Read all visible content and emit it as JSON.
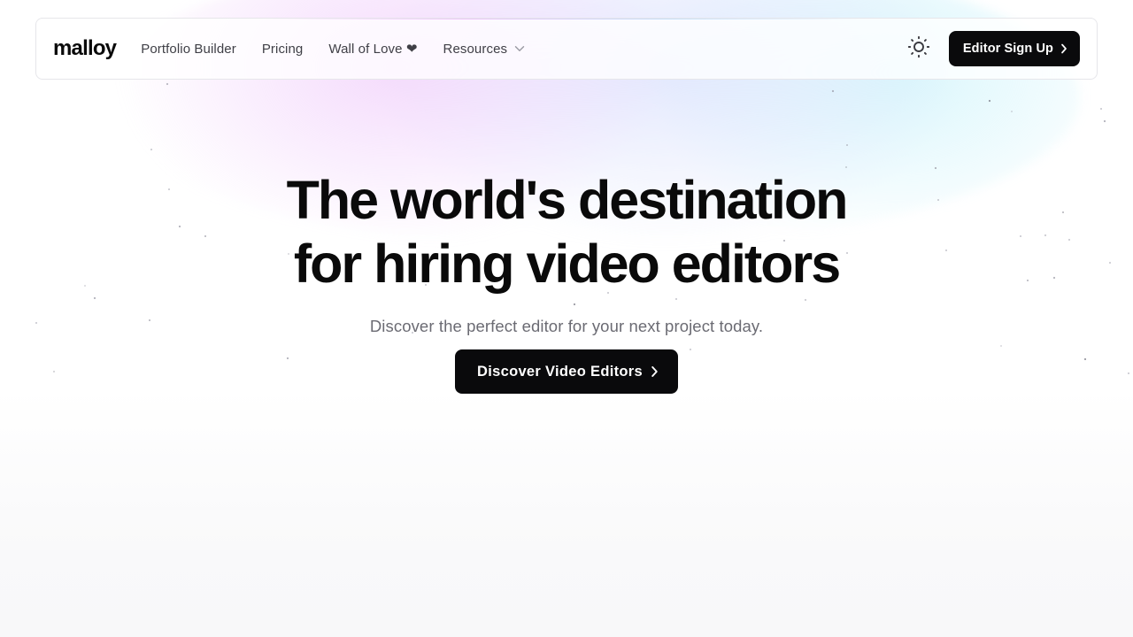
{
  "nav": {
    "logo": "malloy",
    "links": [
      {
        "label": "Portfolio Builder"
      },
      {
        "label": "Pricing"
      },
      {
        "label": "Wall of Love ❤"
      },
      {
        "label": "Resources"
      }
    ],
    "theme_toggle_icon": "sun-icon",
    "signup_label": "Editor Sign Up"
  },
  "hero": {
    "title_line1": "The world's destination",
    "title_line2": "for hiring video editors",
    "subtitle": "Discover the perfect editor for your next project today.",
    "cta_label": "Discover Video Editors"
  },
  "colors": {
    "primary": "#0a0a0c",
    "text_muted": "#6b6b73",
    "nav_text": "#3f3f46",
    "glow_pink": "#ecbefa",
    "glow_blue": "#cdd6fc",
    "glow_cyan": "#bef0fa"
  }
}
